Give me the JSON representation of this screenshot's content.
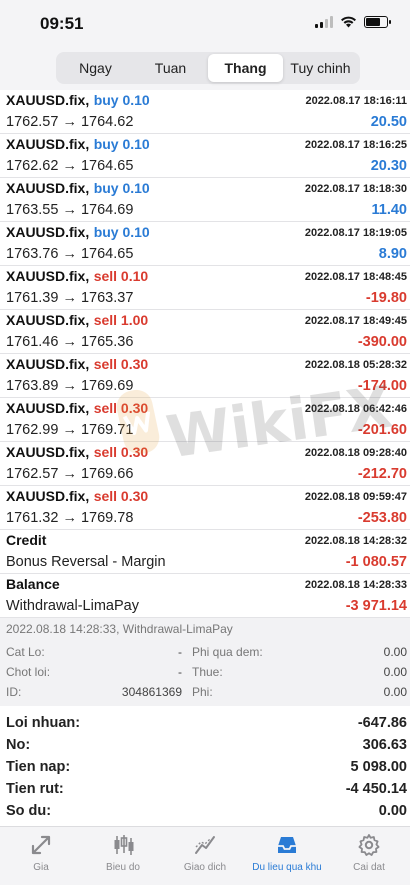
{
  "status": {
    "time": "09:51"
  },
  "period_tabs": [
    {
      "label": "Ngay",
      "active": false
    },
    {
      "label": "Tuan",
      "active": false
    },
    {
      "label": "Thang",
      "active": true
    },
    {
      "label": "Tuy chinh",
      "active": false
    }
  ],
  "rows": [
    {
      "symbol": "XAUUSD.fix,",
      "side": "buy 0.10",
      "kind": "buy",
      "datetime": "2022.08.17 18:16:11",
      "prices": "1762.57 → 1764.62",
      "pnl": "20.50",
      "sign": "pos"
    },
    {
      "symbol": "XAUUSD.fix,",
      "side": "buy 0.10",
      "kind": "buy",
      "datetime": "2022.08.17 18:16:25",
      "prices": "1762.62 → 1764.65",
      "pnl": "20.30",
      "sign": "pos"
    },
    {
      "symbol": "XAUUSD.fix,",
      "side": "buy 0.10",
      "kind": "buy",
      "datetime": "2022.08.17 18:18:30",
      "prices": "1763.55 → 1764.69",
      "pnl": "11.40",
      "sign": "pos"
    },
    {
      "symbol": "XAUUSD.fix,",
      "side": "buy 0.10",
      "kind": "buy",
      "datetime": "2022.08.17 18:19:05",
      "prices": "1763.76 → 1764.65",
      "pnl": "8.90",
      "sign": "pos"
    },
    {
      "symbol": "XAUUSD.fix,",
      "side": "sell 0.10",
      "kind": "sell",
      "datetime": "2022.08.17 18:48:45",
      "prices": "1761.39 → 1763.37",
      "pnl": "-19.80",
      "sign": "neg"
    },
    {
      "symbol": "XAUUSD.fix,",
      "side": "sell 1.00",
      "kind": "sell",
      "datetime": "2022.08.17 18:49:45",
      "prices": "1761.46 → 1765.36",
      "pnl": "-390.00",
      "sign": "neg"
    },
    {
      "symbol": "XAUUSD.fix,",
      "side": "sell 0.30",
      "kind": "sell",
      "datetime": "2022.08.18 05:28:32",
      "prices": "1763.89 → 1769.69",
      "pnl": "-174.00",
      "sign": "neg"
    },
    {
      "symbol": "XAUUSD.fix,",
      "side": "sell 0.30",
      "kind": "sell",
      "datetime": "2022.08.18 06:42:46",
      "prices": "1762.99 → 1769.71",
      "pnl": "-201.60",
      "sign": "neg"
    },
    {
      "symbol": "XAUUSD.fix,",
      "side": "sell 0.30",
      "kind": "sell",
      "datetime": "2022.08.18 09:28:40",
      "prices": "1762.57 → 1769.66",
      "pnl": "-212.70",
      "sign": "neg"
    },
    {
      "symbol": "XAUUSD.fix,",
      "side": "sell 0.30",
      "kind": "sell",
      "datetime": "2022.08.18 09:59:47",
      "prices": "1761.32 → 1769.78",
      "pnl": "-253.80",
      "sign": "neg"
    },
    {
      "symbol": "Credit",
      "side": "",
      "kind": "none",
      "datetime": "2022.08.18 14:28:32",
      "prices": "Bonus Reversal - Margin",
      "pnl": "-1 080.57",
      "sign": "neg"
    },
    {
      "symbol": "Balance",
      "side": "",
      "kind": "none",
      "datetime": "2022.08.18 14:28:33",
      "prices": "Withdrawal-LimaPay",
      "pnl": "-3 971.14",
      "sign": "neg"
    }
  ],
  "detail": {
    "title": "2022.08.18 14:28:33, Withdrawal-LimaPay",
    "cat_lo_label": "Cat Lo:",
    "cat_lo_value": "-",
    "chot_loi_label": "Chot loi:",
    "chot_loi_value": "-",
    "id_label": "ID:",
    "id_value": "304861369",
    "phi_qua_dem_label": "Phi qua dem:",
    "phi_qua_dem_value": "0.00",
    "thue_label": "Thue:",
    "thue_value": "0.00",
    "phi_label": "Phi:",
    "phi_value": "0.00"
  },
  "summary": [
    {
      "label": "Loi nhuan:",
      "value": "-647.86"
    },
    {
      "label": "No:",
      "value": "306.63"
    },
    {
      "label": "Tien nap:",
      "value": "5 098.00"
    },
    {
      "label": "Tien rut:",
      "value": "-4 450.14"
    },
    {
      "label": "So du:",
      "value": "0.00"
    }
  ],
  "tabbar": [
    {
      "label": "Gia",
      "icon": "price-arrows-icon",
      "active": false
    },
    {
      "label": "Bieu do",
      "icon": "candlestick-chart-icon",
      "active": false
    },
    {
      "label": "Giao dich",
      "icon": "trade-line-icon",
      "active": false
    },
    {
      "label": "Du lieu qua khu",
      "icon": "history-inbox-icon",
      "active": true
    },
    {
      "label": "Cai dat",
      "icon": "gear-icon",
      "active": false
    }
  ],
  "watermark": {
    "text": "WikiFX"
  },
  "colors": {
    "buy": "#2a7bd5",
    "sell": "#d93b2f",
    "active_tab": "#2a7bd5",
    "watermark_logo": "#e8a23a"
  }
}
